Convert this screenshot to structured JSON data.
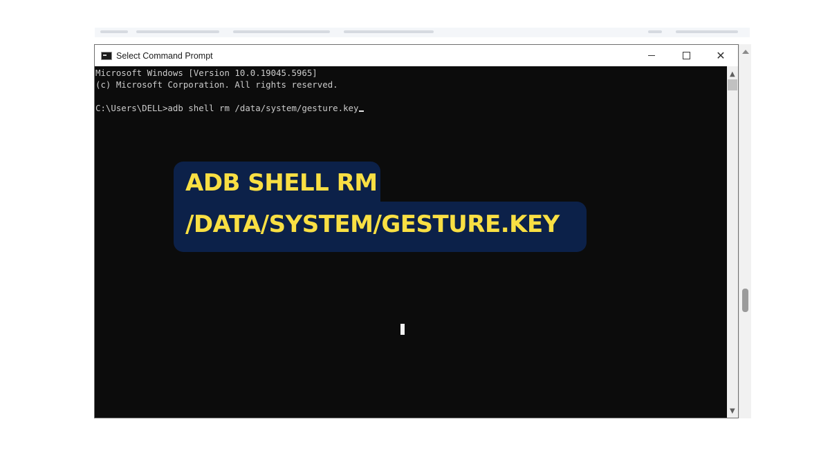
{
  "window": {
    "title": "Select Command Prompt",
    "close_glyph": "✕",
    "icons": [
      "cmd-app-icon",
      "minimize-icon",
      "maximize-icon",
      "close-icon"
    ]
  },
  "console": {
    "lines": [
      "Microsoft Windows [Version 10.0.19045.5965]",
      "(c) Microsoft Corporation. All rights reserved.",
      "",
      "C:\\Users\\DELL>adb shell rm /data/system/gesture.key"
    ]
  },
  "scrollbar": {
    "up_glyph": "▲",
    "down_glyph": "▼"
  },
  "caption": {
    "line1": "ADB SHELL RM",
    "line2": "/DATA/SYSTEM/GESTURE.KEY",
    "text_color": "#f9df43",
    "background_color": "#0c2149"
  },
  "colors": {
    "console_bg": "#0c0c0c",
    "console_text": "#cccccc"
  }
}
